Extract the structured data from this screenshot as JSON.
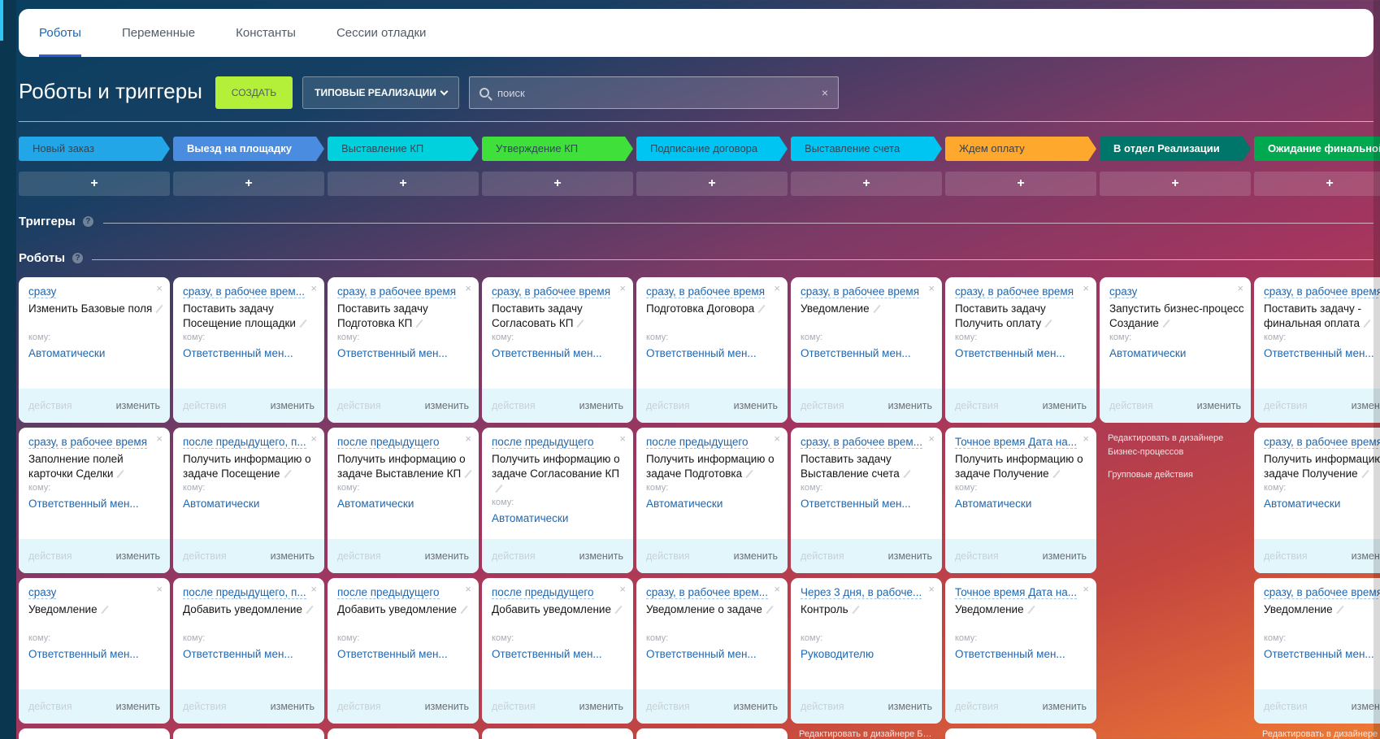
{
  "tabs": [
    {
      "label": "Роботы",
      "active": true
    },
    {
      "label": "Переменные"
    },
    {
      "label": "Константы"
    },
    {
      "label": "Сессии отладки"
    }
  ],
  "header": {
    "title": "Роботы и триггеры",
    "create_label": "СОЗДАТЬ",
    "typical_label": "ТИПОВЫЕ РЕАЛИЗАЦИИ",
    "search_placeholder": "поиск",
    "search_clear": "×"
  },
  "stages": [
    {
      "name": "Новый заказ",
      "color": "#22a6e8",
      "text": "#2f4658",
      "bold": false
    },
    {
      "name": "Выезд на площадку",
      "color": "#4a8ce0",
      "text": "#ffffff",
      "bold": true
    },
    {
      "name": "Выставление КП",
      "color": "#00d1dc",
      "text": "#2f4658",
      "bold": false
    },
    {
      "name": "Утверждение КП",
      "color": "#3fe03a",
      "text": "#2f4658",
      "bold": false
    },
    {
      "name": "Подписание договора",
      "color": "#00c4f2",
      "text": "#2f4658",
      "bold": false
    },
    {
      "name": "Выставление счета",
      "color": "#00c4f2",
      "text": "#2f4658",
      "bold": false
    },
    {
      "name": "Ждем оплату",
      "color": "#ffa82e",
      "text": "#3e3e3e",
      "bold": false
    },
    {
      "name": "В отдел Реализации",
      "color": "#00756a",
      "text": "#ffffff",
      "bold": true
    },
    {
      "name": "Ожидание финальной оплаты",
      "color": "#00a850",
      "text": "#ffffff",
      "bold": true
    }
  ],
  "add_label": "+",
  "sections": {
    "triggers": "Триггеры",
    "robots": "Роботы",
    "help": "?"
  },
  "card_labels": {
    "to": "кому:",
    "actions": "действия",
    "edit": "изменить",
    "close": "×"
  },
  "column_links": {
    "designer": "Редактировать в дизайнере Бизнес-процессов",
    "group": "Групповые действия"
  },
  "robot_rows": [
    [
      {
        "timing": "сразу",
        "title": "Изменить Базовые поля",
        "to": "Автоматически"
      },
      {
        "timing": "сразу, в рабочее врем...",
        "title": "Поставить задачу Посещение площадки",
        "to": "Ответственный мен..."
      },
      {
        "timing": "сразу, в рабочее время",
        "title": "Поставить задачу Подготовка КП",
        "to": "Ответственный мен..."
      },
      {
        "timing": "сразу, в рабочее время",
        "title": "Поставить задачу Согласовать КП",
        "to": "Ответственный мен..."
      },
      {
        "timing": "сразу, в рабочее время",
        "title": "Подготовка Договора",
        "to": "Ответственный мен..."
      },
      {
        "timing": "сразу, в рабочее время",
        "title": "Уведомление",
        "to": "Ответственный мен..."
      },
      {
        "timing": "сразу, в рабочее время",
        "title": "Поставить задачу Получить оплату",
        "to": "Ответственный мен..."
      },
      {
        "timing": "сразу",
        "title": "Запустить бизнес-процесс Создание",
        "to": "Автоматически"
      },
      {
        "timing": "сразу, в рабочее время",
        "title": "Поставить задачу - финальная оплата",
        "to": "Ответственный мен..."
      }
    ],
    [
      {
        "timing": "сразу, в рабочее время",
        "title": "Заполнение полей карточки Сделки",
        "to": "Ответственный мен..."
      },
      {
        "timing": "после предыдущего, п...",
        "title": "Получить информацию о задаче Посещение",
        "to": "Автоматически"
      },
      {
        "timing": "после предыдущего",
        "title": "Получить информацию о задаче Выставление КП",
        "to": "Автоматически"
      },
      {
        "timing": "после предыдущего",
        "title": "Получить информацию о задаче Согласование КП",
        "to": "Автоматически"
      },
      {
        "timing": "после предыдущего",
        "title": "Получить информацию о задаче Подготовка",
        "to": "Автоматически"
      },
      {
        "timing": "сразу, в рабочее врем...",
        "title": "Поставить задачу Выставление счета",
        "to": "Ответственный мен..."
      },
      {
        "timing": "Точное время Дата на...",
        "title": "Получить информацию о задаче Получение",
        "to": "Автоматически"
      },
      {
        "links": true
      },
      {
        "timing": "сразу, в рабочее время",
        "title": "Получить информацию о задаче Получение",
        "to": "Автоматически"
      }
    ],
    [
      {
        "timing": "сразу",
        "title": "Уведомление",
        "to": "Ответственный мен..."
      },
      {
        "timing": "после предыдущего, п...",
        "title": "Добавить уведомление",
        "to": "Ответственный мен..."
      },
      {
        "timing": "после предыдущего",
        "title": "Добавить уведомление",
        "to": "Ответственный мен..."
      },
      {
        "timing": "после предыдущего",
        "title": "Добавить уведомление",
        "to": "Ответственный мен..."
      },
      {
        "timing": "сразу, в рабочее врем...",
        "title": "Уведомление о задаче",
        "to": "Ответственный мен..."
      },
      {
        "timing": "Через 3 дня, в рабоче...",
        "title": "Контроль",
        "to": "Руководителю"
      },
      {
        "timing": "Точное время Дата на...",
        "title": "Уведомление",
        "to": "Ответственный мен..."
      },
      {
        "empty": true
      },
      {
        "timing": "сразу, в рабочее время",
        "title": "Уведомление",
        "to": "Ответственный мен..."
      }
    ],
    [
      {
        "blank": true
      },
      {
        "blank": true
      },
      {
        "blank": true
      },
      {
        "blank": true
      },
      {
        "blank": true
      },
      {
        "links": true
      },
      {
        "blank": true
      },
      {
        "empty": true
      },
      {
        "links": true
      }
    ]
  ]
}
